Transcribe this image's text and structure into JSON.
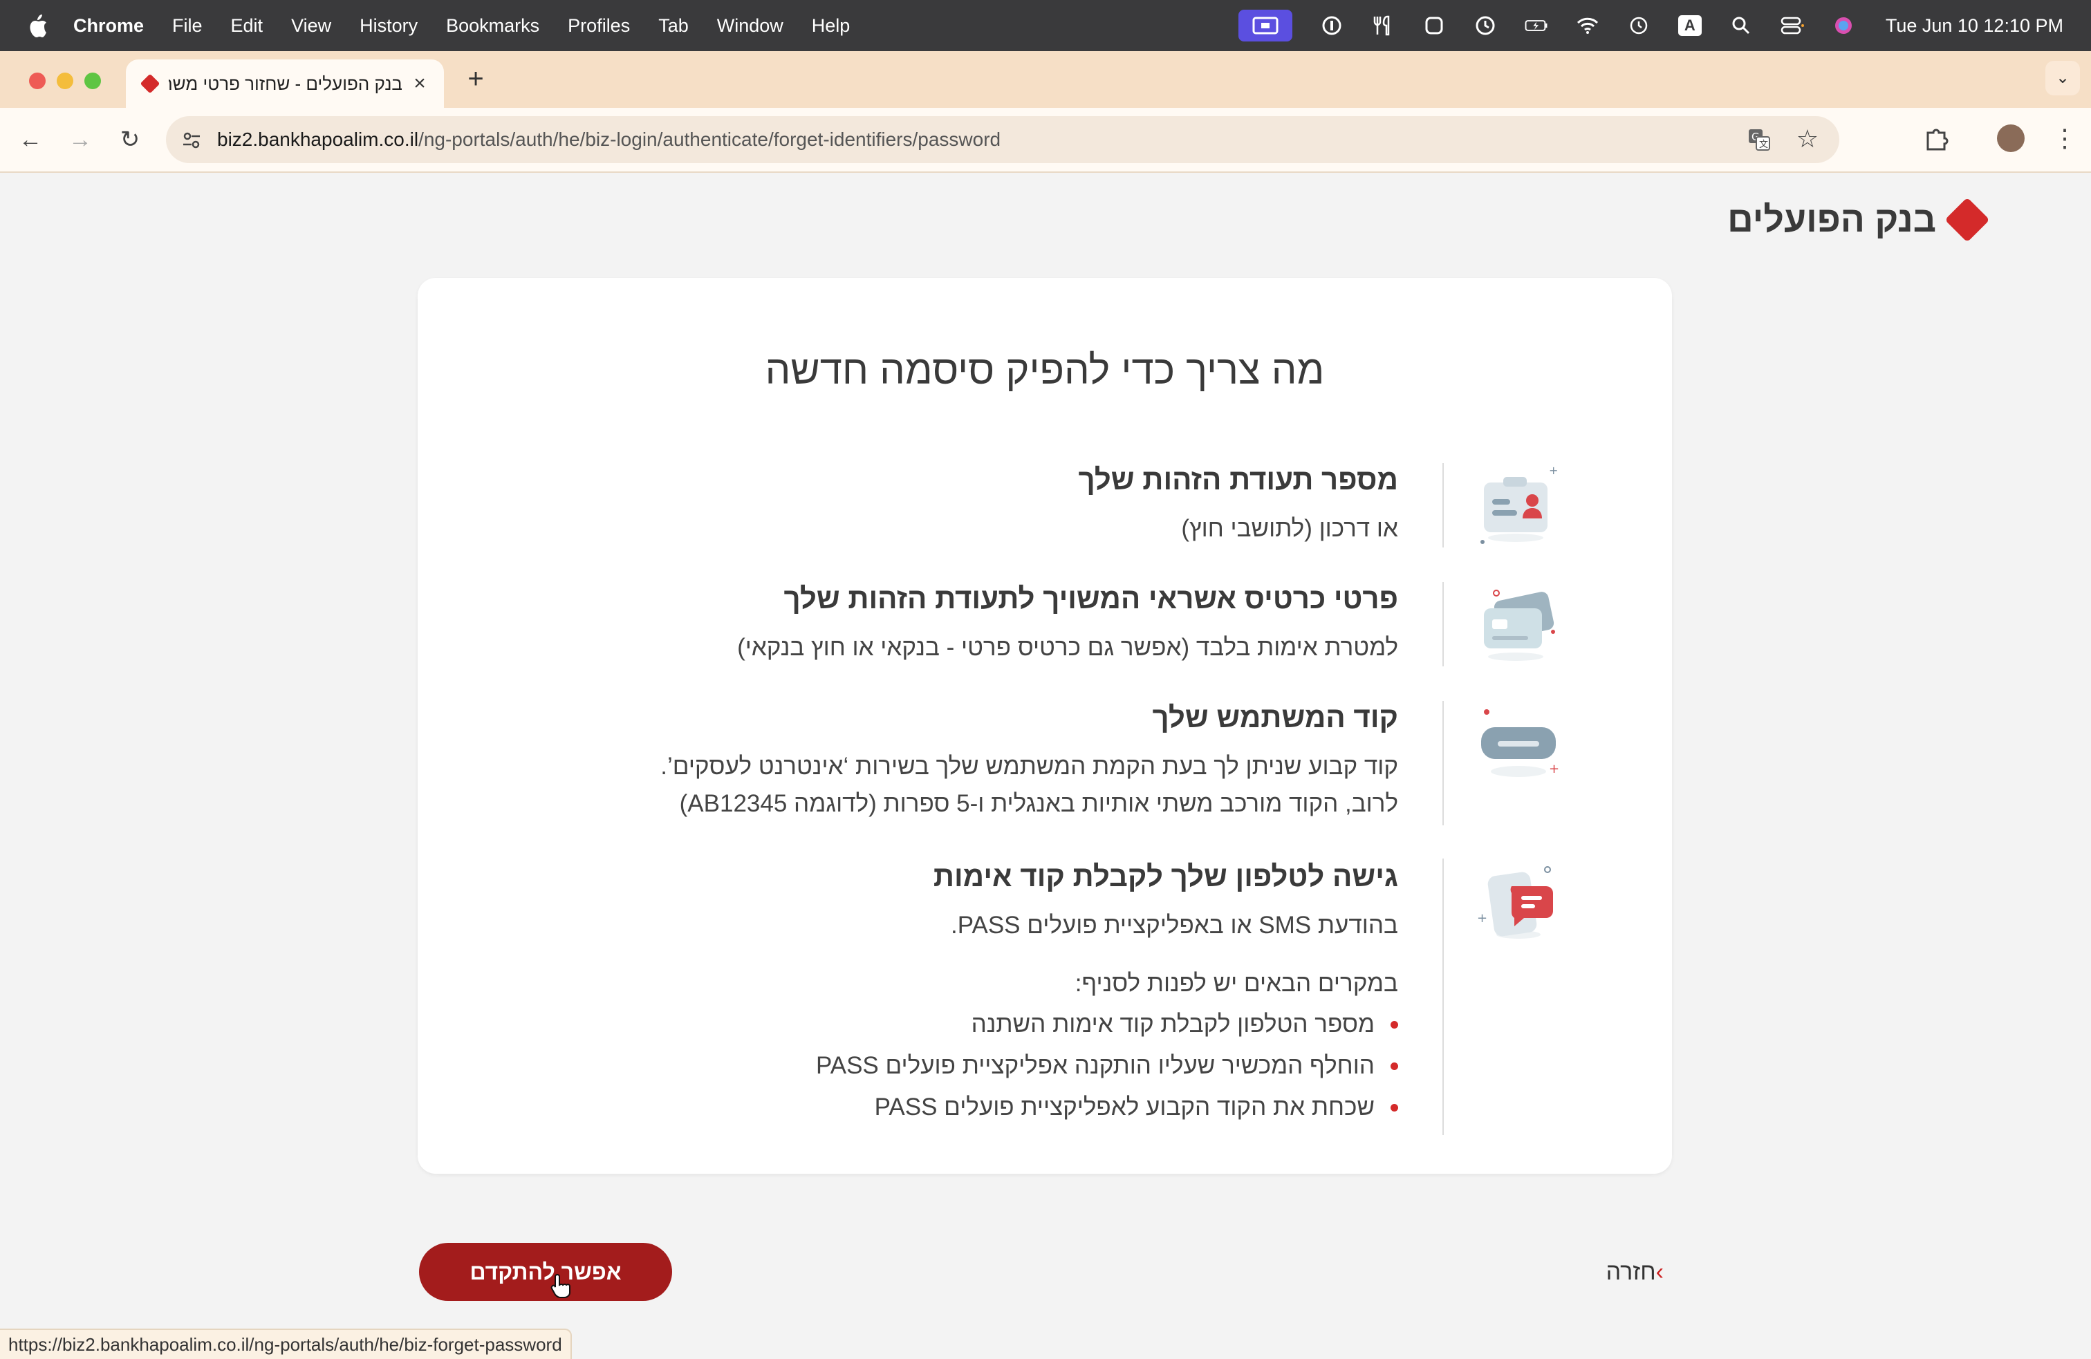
{
  "menubar": {
    "items": [
      "Chrome",
      "File",
      "Edit",
      "View",
      "History",
      "Bookmarks",
      "Profiles",
      "Tab",
      "Window",
      "Help"
    ],
    "clock": "Tue Jun 10  12:10 PM",
    "input_indicator": "A"
  },
  "browser": {
    "tab_title": "בנק הפועלים - שחזור פרטי משתמש",
    "url_domain": "biz2.bankhapoalim.co.il",
    "url_path": "/ng-portals/auth/he/biz-login/authenticate/forget-identifiers/password",
    "status_url": "https://biz2.bankhapoalim.co.il/ng-portals/auth/he/biz-forget-password"
  },
  "page": {
    "logo_text": "בנק הפועלים",
    "title": "מה צריך כדי להפיק סיסמה חדשה",
    "items": [
      {
        "heading": "מספר תעודת הזהות שלך",
        "lines": [
          "או דרכון (לתושבי חוץ)"
        ]
      },
      {
        "heading": "פרטי כרטיס אשראי המשויך לתעודת הזהות שלך",
        "lines": [
          "למטרת אימות בלבד (אפשר גם כרטיס פרטי - בנקאי או חוץ בנקאי)"
        ]
      },
      {
        "heading": "קוד המשתמש שלך",
        "lines": [
          "קוד קבוע שניתן לך בעת הקמת המשתמש שלך בשירות ‘אינטרנט לעסקים’.",
          "לרוב, הקוד מורכב משתי אותיות באנגלית ו-5 ספרות (לדוגמה AB12345)"
        ]
      },
      {
        "heading": "גישה לטלפון שלך לקבלת קוד אימות",
        "lines": [
          "בהודעת SMS או באפליקציית פועלים PASS."
        ],
        "note": "במקרים הבאים יש לפנות לסניף:",
        "bullets": [
          "מספר הטלפון לקבלת קוד אימות השתנה",
          "הוחלף המכשיר שעליו הותקנה אפליקציית פועלים PASS",
          "שכחת את הקוד הקבוע לאפליקציית פועלים PASS"
        ]
      }
    ],
    "primary_button": "אפשר להתקדם",
    "back_link": "חזרה"
  },
  "colors": {
    "brand_red": "#d42a2a",
    "button_red": "#a31c1c"
  }
}
